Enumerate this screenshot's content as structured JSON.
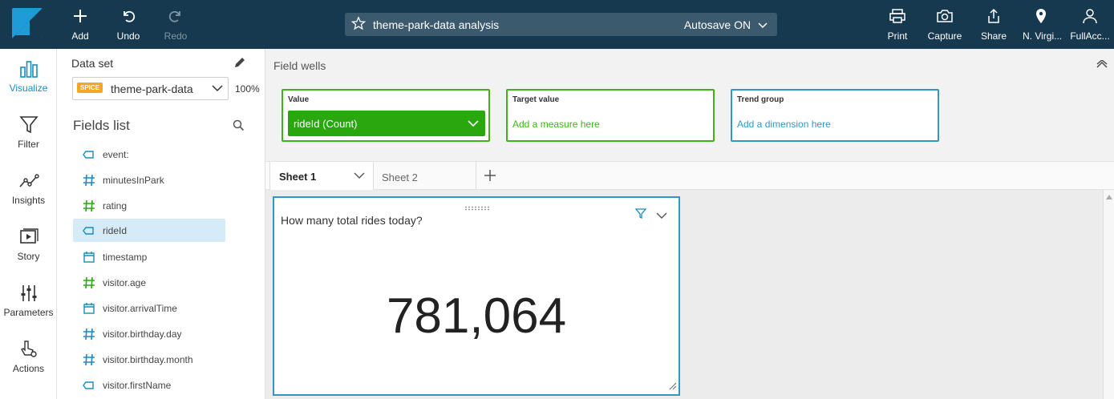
{
  "topbar": {
    "add_label": "Add",
    "undo_label": "Undo",
    "redo_label": "Redo",
    "analysis_title": "theme-park-data analysis",
    "autosave_label": "Autosave ON",
    "print_label": "Print",
    "capture_label": "Capture",
    "share_label": "Share",
    "region_label": "N. Virgi...",
    "account_label": "FullAcc..."
  },
  "leftnav": {
    "items": [
      {
        "label": "Visualize",
        "icon": "bar-chart-icon",
        "active": true
      },
      {
        "label": "Filter",
        "icon": "funnel-icon"
      },
      {
        "label": "Insights",
        "icon": "insights-icon"
      },
      {
        "label": "Story",
        "icon": "story-icon"
      },
      {
        "label": "Parameters",
        "icon": "sliders-icon"
      },
      {
        "label": "Actions",
        "icon": "pointer-gear-icon"
      }
    ]
  },
  "dataset": {
    "label": "Data set",
    "badge": "SPICE",
    "name": "theme-park-data",
    "spice_percent": "100%"
  },
  "fields_list": {
    "title": "Fields list",
    "fields": [
      {
        "name": "event:",
        "type": "dimension"
      },
      {
        "name": "minutesInPark",
        "type": "measure"
      },
      {
        "name": "rating",
        "type": "measure-green"
      },
      {
        "name": "rideId",
        "type": "dimension",
        "selected": true
      },
      {
        "name": "timestamp",
        "type": "date"
      },
      {
        "name": "visitor.age",
        "type": "measure-green"
      },
      {
        "name": "visitor.arrivalTime",
        "type": "date"
      },
      {
        "name": "visitor.birthday.day",
        "type": "measure"
      },
      {
        "name": "visitor.birthday.month",
        "type": "measure"
      },
      {
        "name": "visitor.firstName",
        "type": "dimension"
      }
    ]
  },
  "field_wells": {
    "title": "Field wells",
    "value_label": "Value",
    "value_field": "rideId (Count)",
    "target_label": "Target value",
    "target_placeholder": "Add a measure here",
    "trend_label": "Trend group",
    "trend_placeholder": "Add a dimension here"
  },
  "sheets": {
    "tab1": "Sheet 1",
    "tab2": "Sheet 2"
  },
  "visual": {
    "title": "How many total rides today?",
    "kpi_value": "781,064"
  },
  "colors": {
    "topbar": "#16394f",
    "accent_blue": "#1a8bbd",
    "well_green": "#3db517",
    "pill_green": "#2aa70f",
    "spice_orange": "#f5a623"
  }
}
